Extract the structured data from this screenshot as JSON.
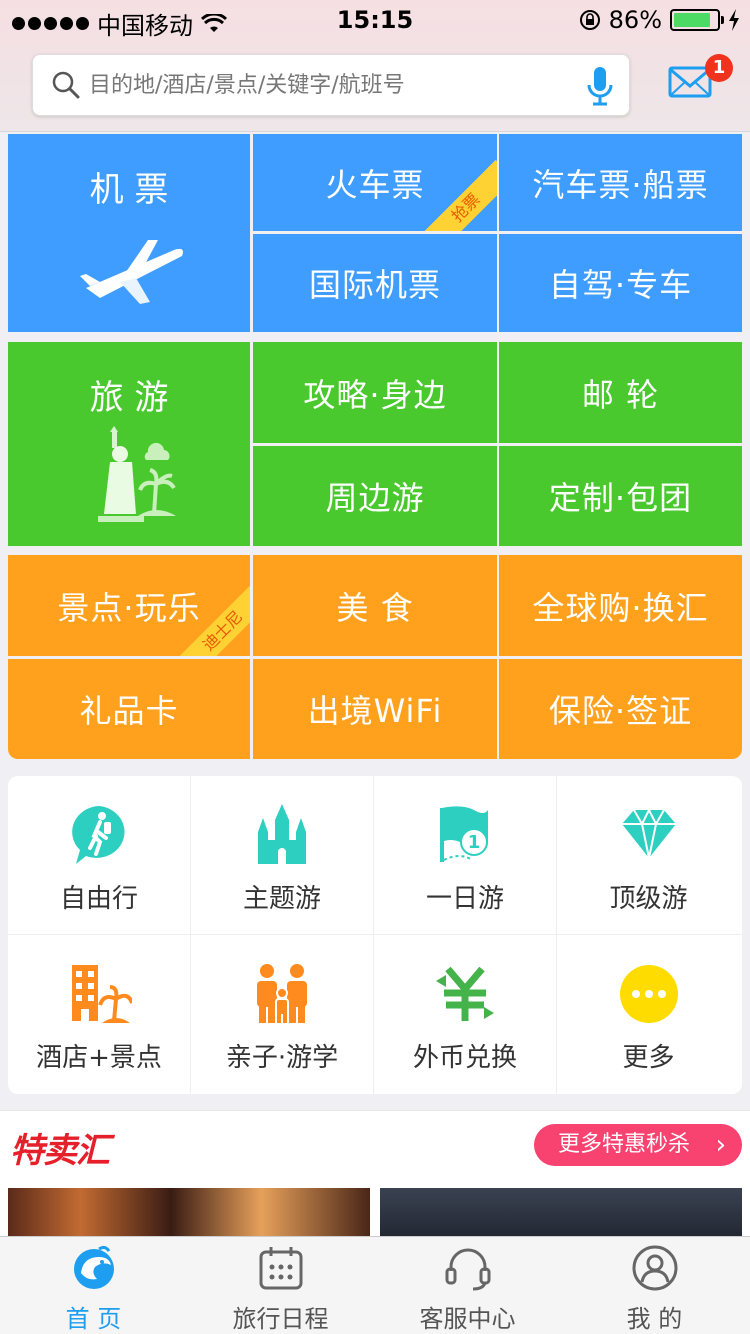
{
  "status_bar": {
    "carrier": "中国移动",
    "time": "15:15",
    "battery": "86%",
    "battery_level": 0.86
  },
  "search": {
    "placeholder": "目的地/酒店/景点/关键字/航班号"
  },
  "header": {
    "mail_badge": "1"
  },
  "grid": {
    "blue": {
      "flight": "机 票",
      "train": "火车票",
      "train_ribbon": "抢票",
      "bus_ship": "汽车票·船票",
      "intl_flight": "国际机票",
      "car": "自驾·专车"
    },
    "green": {
      "travel": "旅 游",
      "guide": "攻略·身边",
      "cruise": "邮 轮",
      "nearby": "周边游",
      "custom": "定制·包团"
    },
    "orange": {
      "attractions": "景点·玩乐",
      "attractions_ribbon": "迪士尼",
      "food": "美 食",
      "shopping": "全球购·换汇",
      "giftcard": "礼品卡",
      "wifi": "出境WiFi",
      "insurance": "保险·签证"
    }
  },
  "icon_grid": [
    {
      "label": "自由行",
      "icon": "walker-icon"
    },
    {
      "label": "主题游",
      "icon": "castle-icon"
    },
    {
      "label": "一日游",
      "icon": "flag-icon"
    },
    {
      "label": "顶级游",
      "icon": "diamond-icon"
    },
    {
      "label": "酒店+景点",
      "icon": "hotel-icon"
    },
    {
      "label": "亲子·游学",
      "icon": "family-icon"
    },
    {
      "label": "外币兑换",
      "icon": "currency-icon"
    },
    {
      "label": "更多",
      "icon": "more-icon"
    }
  ],
  "offers": {
    "logo": "特卖汇",
    "more_button": "更多特惠秒杀"
  },
  "tabbar": [
    {
      "label": "首 页",
      "icon": "home-dolphin-icon",
      "active": true
    },
    {
      "label": "旅行日程",
      "icon": "calendar-icon",
      "active": false
    },
    {
      "label": "客服中心",
      "icon": "headset-icon",
      "active": false
    },
    {
      "label": "我 的",
      "icon": "profile-icon",
      "active": false
    }
  ],
  "colors": {
    "blue": "#3e9dfe",
    "green": "#4ac92f",
    "orange": "#ffa11d",
    "accent_teal": "#2ccfc0",
    "accent_orange": "#ff8a1d",
    "tab_active": "#1e9ef0",
    "sale_pink": "#f84270"
  }
}
